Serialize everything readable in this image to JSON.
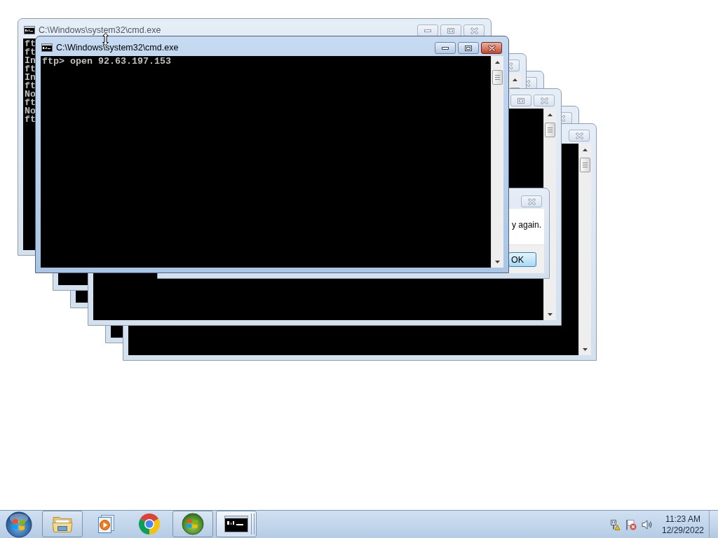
{
  "desktop": {
    "windows": [
      {
        "kind": "console",
        "title": "C:\\Windows\\system32\\cmd.exe",
        "active": false,
        "lines": [
          "ft",
          "ft",
          "In",
          "ft",
          "In",
          "ft",
          "No",
          "ft",
          "No",
          "ft"
        ]
      },
      {
        "kind": "console",
        "title": "C:\\Windows\\system32\\cmd.exe",
        "active": true,
        "lines": [
          "ftp> open 92.63.197.153"
        ]
      },
      {
        "kind": "console",
        "active": false
      },
      {
        "kind": "console",
        "active": false
      },
      {
        "kind": "console",
        "active": false
      },
      {
        "kind": "console",
        "active": false
      },
      {
        "kind": "console",
        "active": false
      },
      {
        "kind": "message",
        "active": false,
        "message": "y again.",
        "button": "OK"
      }
    ]
  },
  "taskbar": {
    "buttons": [
      {
        "running": true,
        "active": false,
        "grouped": false
      },
      {
        "running": false,
        "active": false,
        "grouped": false
      },
      {
        "running": false,
        "active": false,
        "grouped": false
      },
      {
        "running": true,
        "active": false,
        "grouped": false
      },
      {
        "running": true,
        "active": true,
        "grouped": true
      }
    ],
    "clock": {
      "time": "11:23 AM",
      "date": "12/29/2022"
    }
  }
}
